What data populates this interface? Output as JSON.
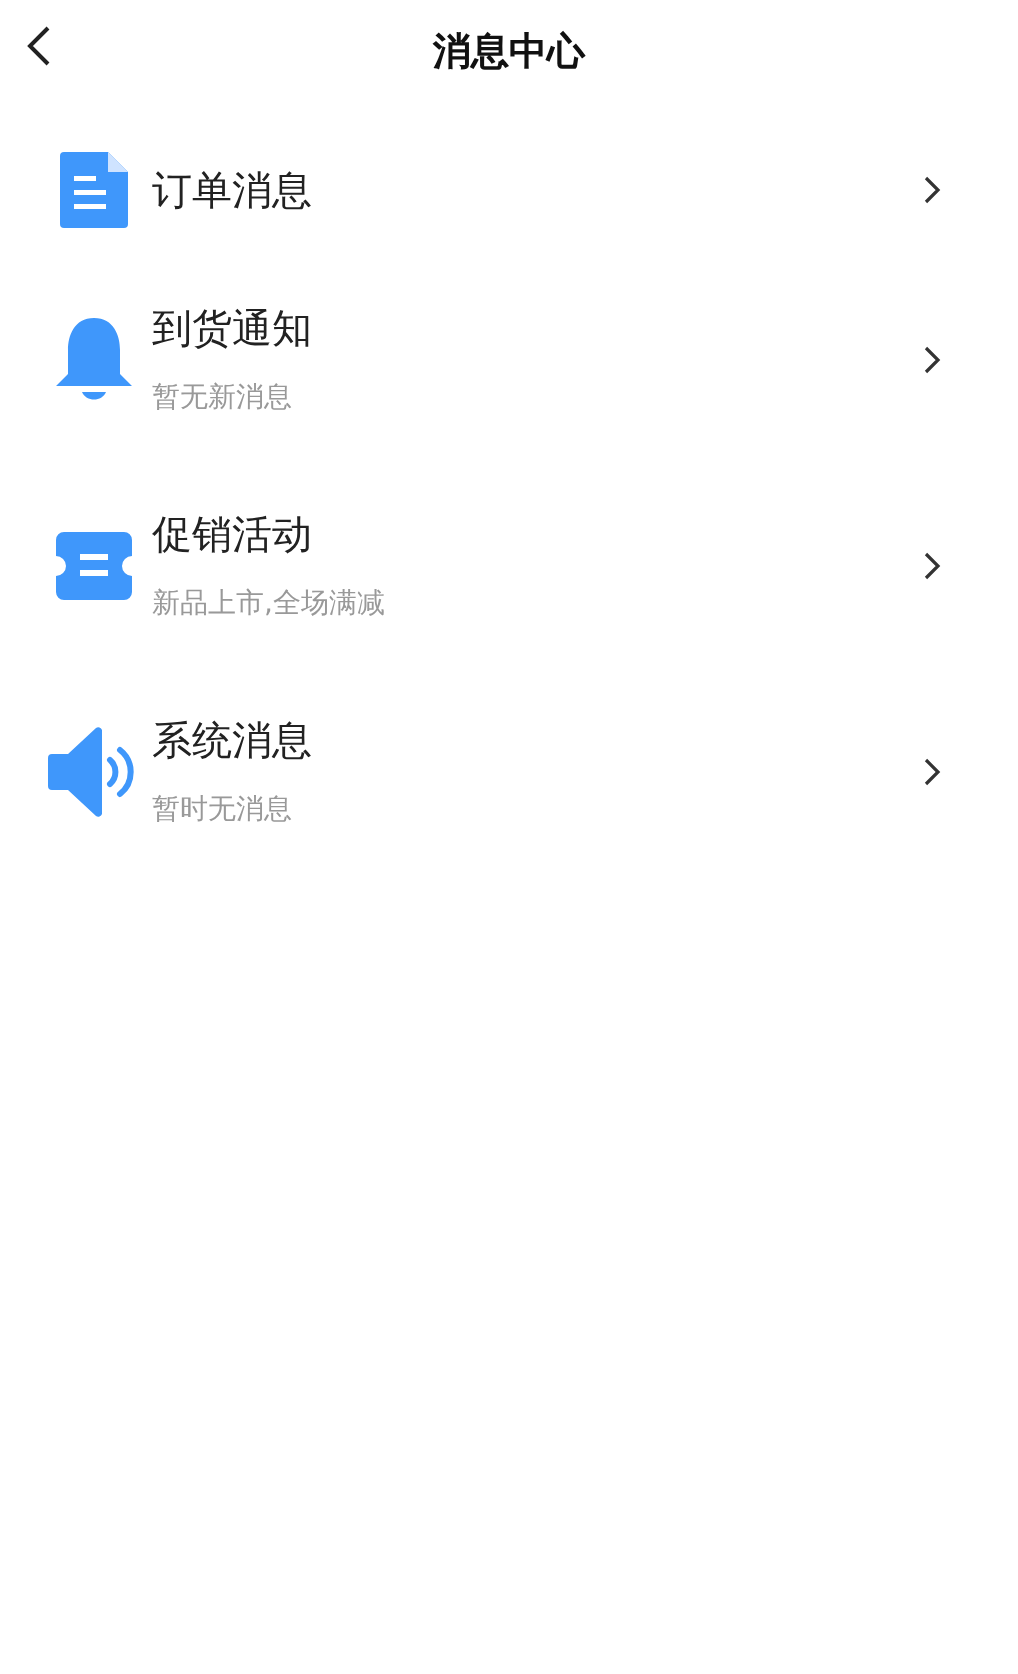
{
  "header": {
    "title": "消息中心"
  },
  "items": [
    {
      "kind": "document",
      "title": "订单消息"
    },
    {
      "kind": "bell",
      "title": "到货通知",
      "subtitle": "暂无新消息"
    },
    {
      "kind": "ticket",
      "title": "促销活动",
      "subtitle": "新品上市,全场满减"
    },
    {
      "kind": "speaker",
      "title": "系统消息",
      "subtitle": "暂时无消息"
    }
  ]
}
